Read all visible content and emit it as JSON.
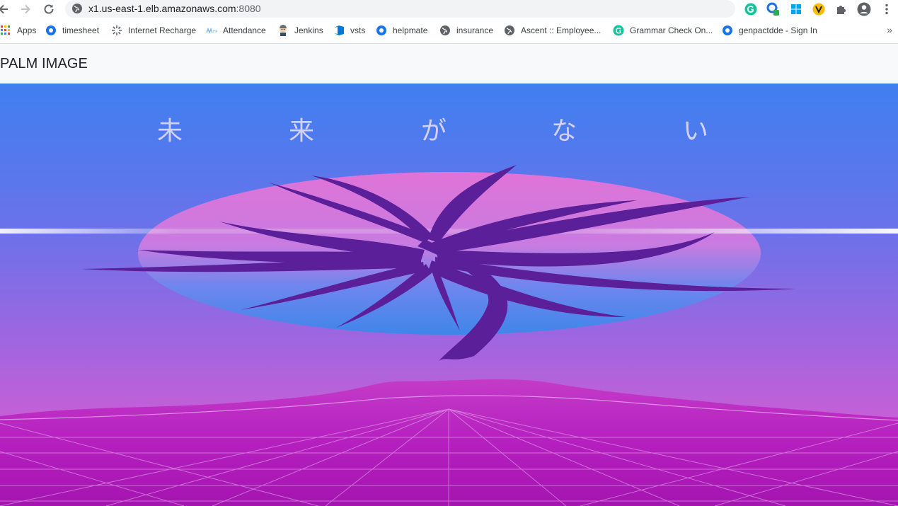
{
  "browser": {
    "url_host": "x1.us-east-1.elb.amazonaws.com",
    "url_port": ":8080",
    "icons": {
      "back": "back-arrow-icon",
      "forward": "forward-arrow-icon",
      "reload": "reload-icon",
      "site_info": "globe-icon",
      "extensions": [
        "grammarly-icon",
        "extension-badge-icon",
        "windows-icon",
        "v-extension-icon",
        "puzzle-icon",
        "profile-icon",
        "kebab-menu-icon"
      ]
    }
  },
  "bookmarks": [
    {
      "label": "Apps",
      "icon": "apps-grid-icon"
    },
    {
      "label": "timesheet",
      "icon": "circle-o-icon"
    },
    {
      "label": "Internet Recharge",
      "icon": "spinner-icon"
    },
    {
      "label": "Attendance",
      "icon": "attendance-icon"
    },
    {
      "label": "Jenkins",
      "icon": "jenkins-icon"
    },
    {
      "label": "vsts",
      "icon": "vsts-icon"
    },
    {
      "label": "helpmate",
      "icon": "circle-o-icon"
    },
    {
      "label": "insurance",
      "icon": "globe-icon"
    },
    {
      "label": "Ascent :: Employee...",
      "icon": "globe-icon"
    },
    {
      "label": "Grammar Check On...",
      "icon": "grammarly-icon"
    },
    {
      "label": "genpactdde - Sign In",
      "icon": "circle-o-icon"
    }
  ],
  "navbar": {
    "brand": "PALM IMAGE"
  },
  "hero": {
    "caption_chars": [
      "未",
      "来",
      "が",
      "な",
      "い"
    ],
    "colors": {
      "sky_top": "#3f7ff0",
      "sky_mid": "#8f63e0",
      "sun_pink": "#e071d6",
      "sun_blue": "#3f86ea",
      "palm": "#5a1f99",
      "grid": "#b51fbf"
    }
  }
}
